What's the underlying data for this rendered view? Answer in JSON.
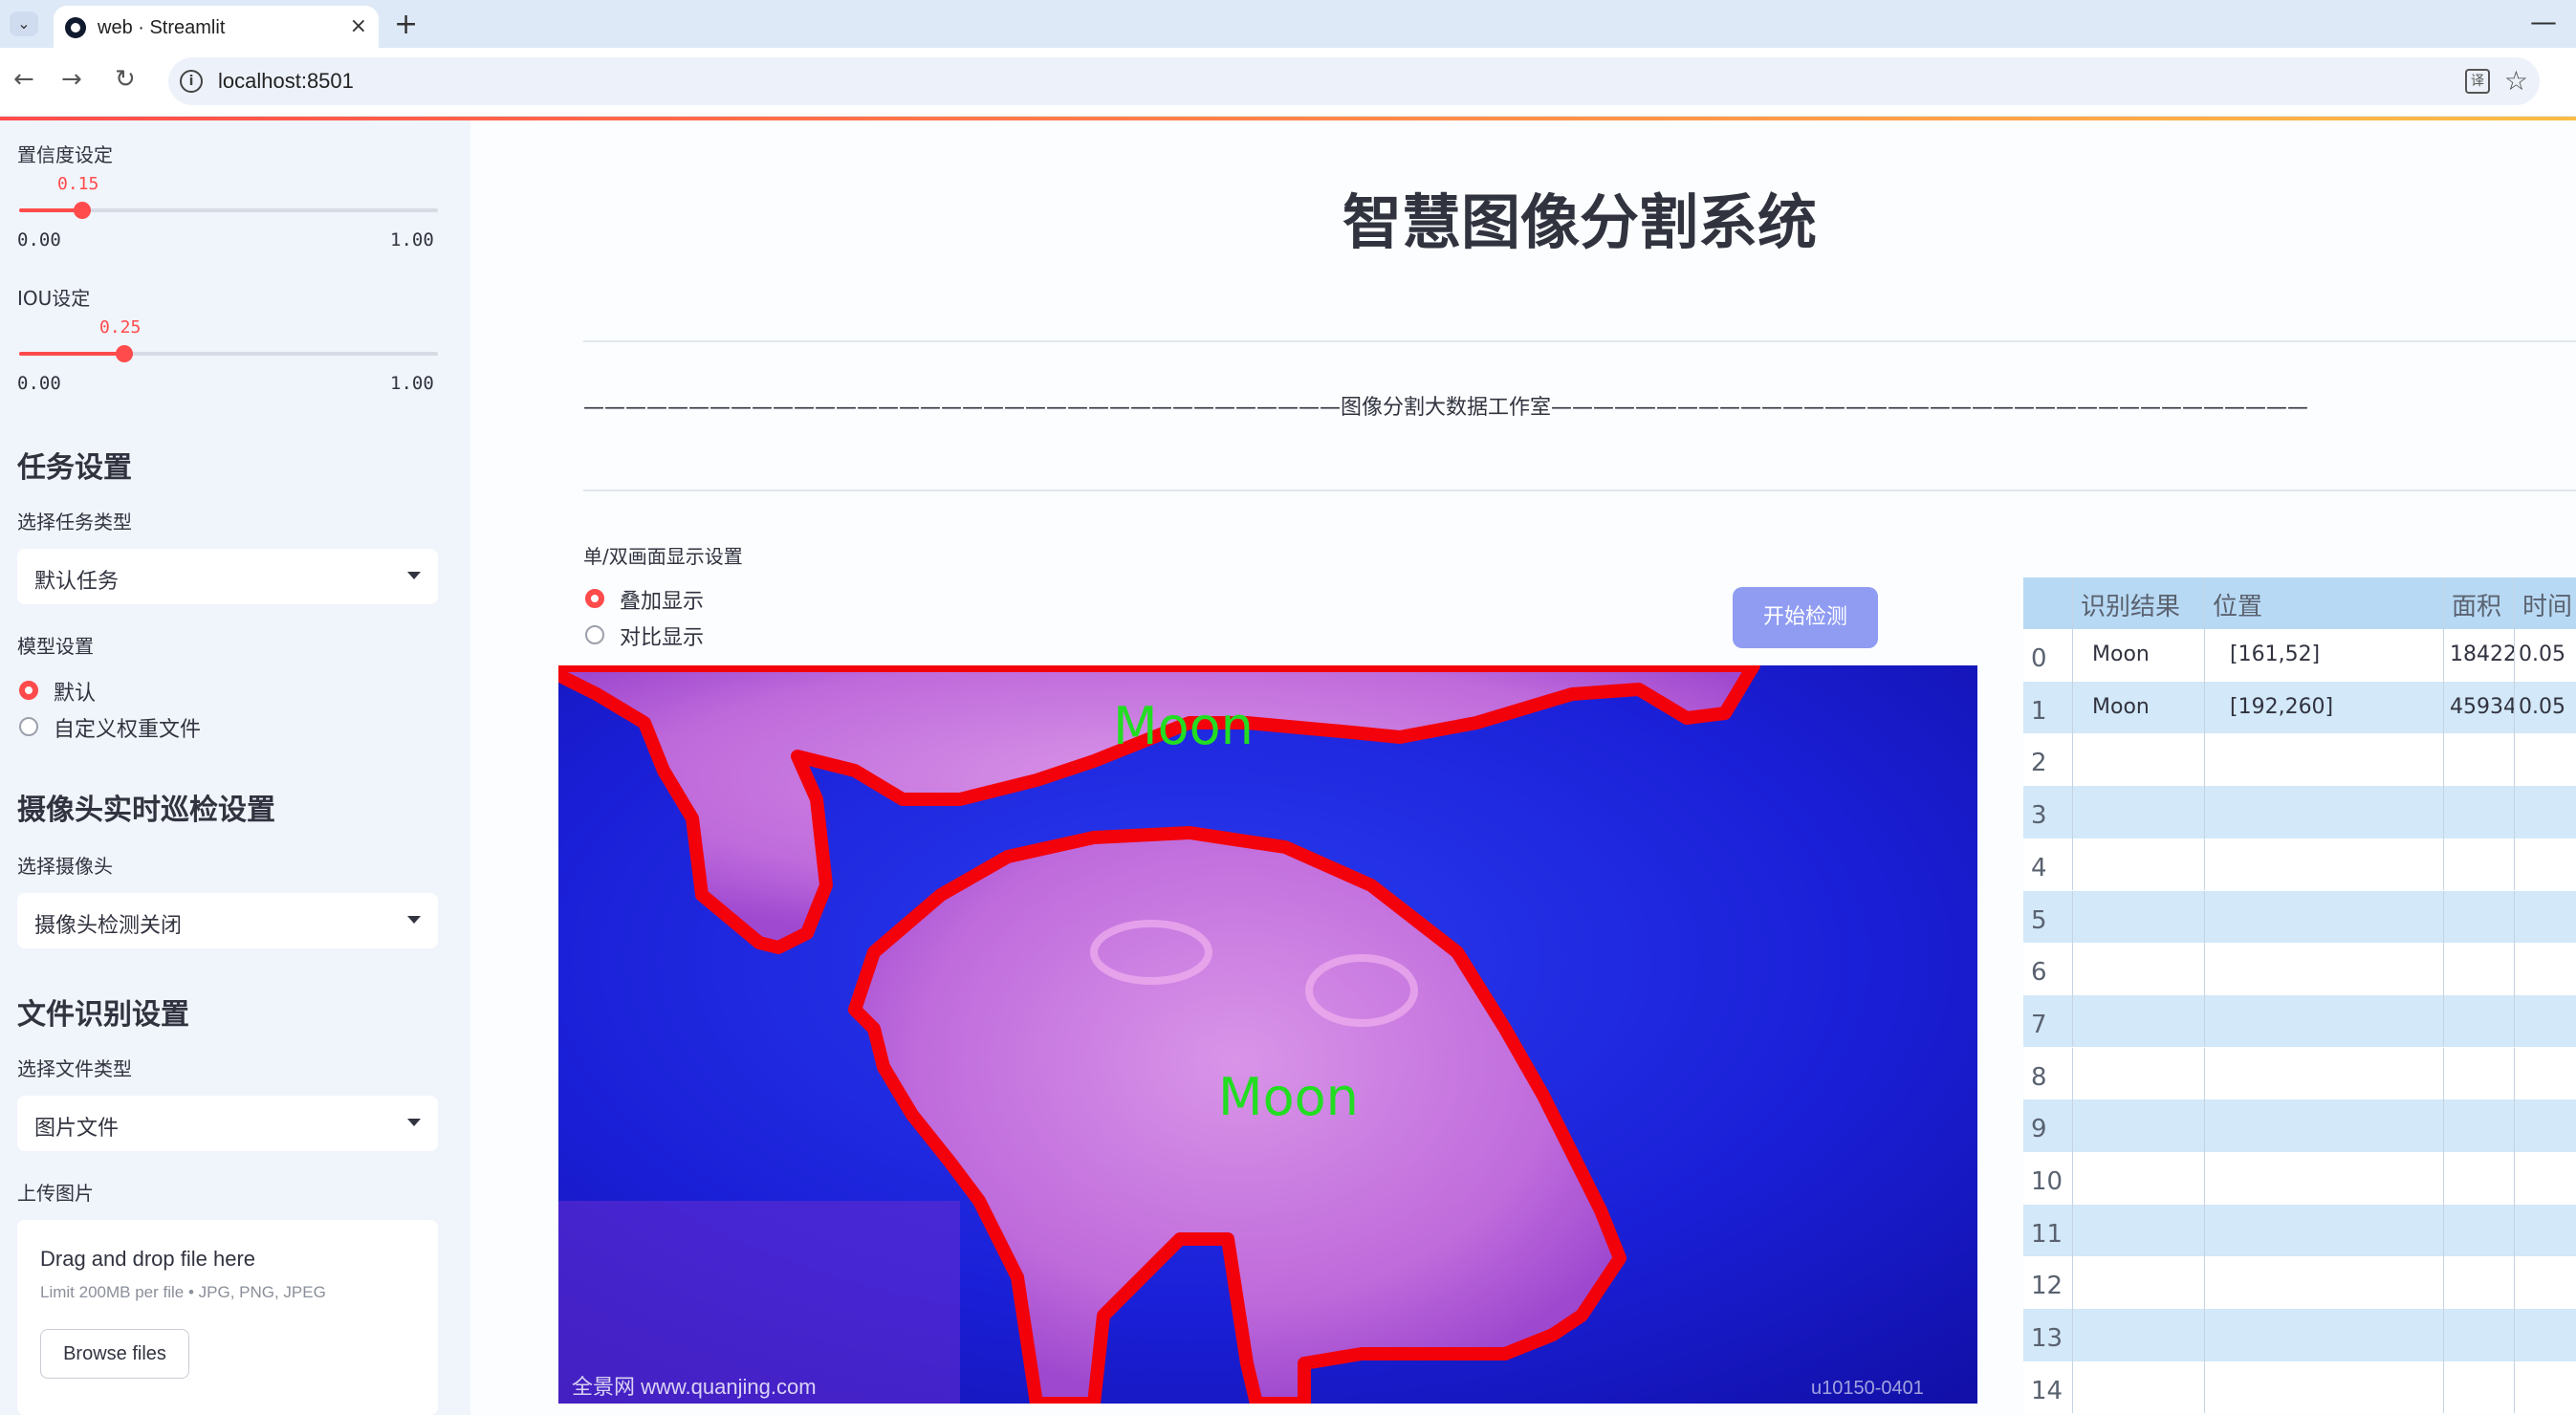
{
  "browser": {
    "tab_title": "web · Streamlit",
    "tab_close": "×",
    "new_tab": "+",
    "minimize": "—",
    "url": "localhost:8501"
  },
  "sidebar": {
    "confidence": {
      "label": "置信度设定",
      "value": "0.15",
      "value_num": 0.15,
      "min": "0.00",
      "max": "1.00"
    },
    "iou": {
      "label": "IOU设定",
      "value": "0.25",
      "value_num": 0.25,
      "min": "0.00",
      "max": "1.00"
    },
    "task_header": "任务设置",
    "task_type_label": "选择任务类型",
    "task_type_value": "默认任务",
    "model_label": "模型设置",
    "model_options": [
      "默认",
      "自定义权重文件"
    ],
    "model_selected": 0,
    "camera_header": "摄像头实时巡检设置",
    "camera_label": "选择摄像头",
    "camera_value": "摄像头检测关闭",
    "file_header": "文件识别设置",
    "file_type_label": "选择文件类型",
    "file_type_value": "图片文件",
    "upload_label": "上传图片",
    "uploader": {
      "title": "Drag and drop file here",
      "subtitle": "Limit 200MB per file • JPG, PNG, JPEG",
      "button": "Browse files"
    }
  },
  "main": {
    "title": "智慧图像分割系统",
    "subtitle_line": "————————————————————————————————————图像分割大数据工作室————————————————————————————————————",
    "display_mode_label": "单/双画面显示设置",
    "display_options": [
      "叠加显示",
      "对比显示"
    ],
    "display_selected": 0,
    "detect_button": "开始检测",
    "image": {
      "labels": [
        "Moon",
        "Moon"
      ],
      "watermark_left": "全景网 www.quanjing.com",
      "watermark_right": "u10150-0401"
    }
  },
  "table": {
    "headers": [
      "",
      "识别结果",
      "位置",
      "面积",
      "时间"
    ],
    "rows": [
      [
        "0",
        "Moon",
        "[161,52]",
        "18422",
        "0.05"
      ],
      [
        "1",
        "Moon",
        "[192,260]",
        "45934",
        "0.05"
      ],
      [
        "2",
        "",
        "",
        "",
        ""
      ],
      [
        "3",
        "",
        "",
        "",
        ""
      ],
      [
        "4",
        "",
        "",
        "",
        ""
      ],
      [
        "5",
        "",
        "",
        "",
        ""
      ],
      [
        "6",
        "",
        "",
        "",
        ""
      ],
      [
        "7",
        "",
        "",
        "",
        ""
      ],
      [
        "8",
        "",
        "",
        "",
        ""
      ],
      [
        "9",
        "",
        "",
        "",
        ""
      ],
      [
        "10",
        "",
        "",
        "",
        ""
      ],
      [
        "11",
        "",
        "",
        "",
        ""
      ],
      [
        "12",
        "",
        "",
        "",
        ""
      ],
      [
        "13",
        "",
        "",
        "",
        ""
      ],
      [
        "14",
        "",
        "",
        "",
        ""
      ]
    ]
  },
  "colors": {
    "accent": "#ff4b4b",
    "button": "#8f9cf2",
    "mask_outline": "#ff0000",
    "label_text": "#22dd22"
  }
}
